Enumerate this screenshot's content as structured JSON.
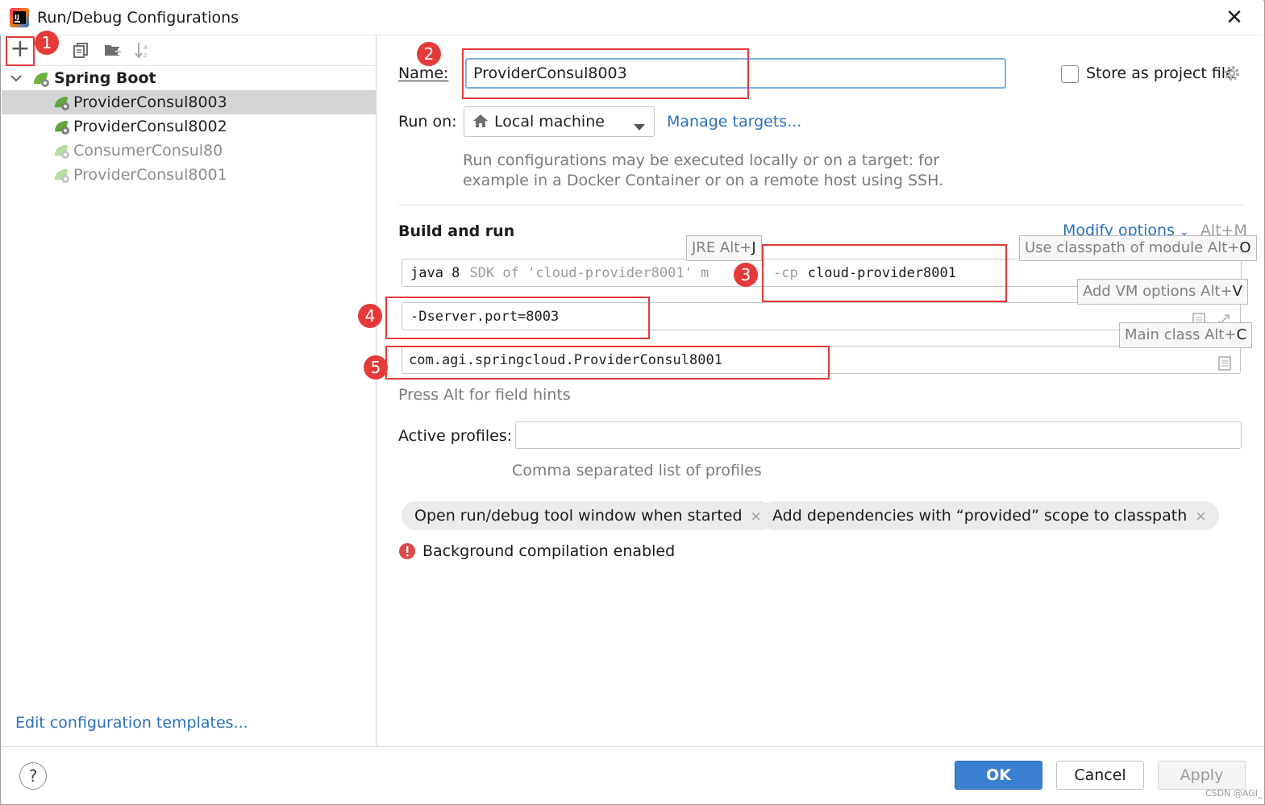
{
  "window": {
    "title": "Run/Debug Configurations",
    "close_glyph": "✕"
  },
  "toolbar": {
    "add_glyph": "+",
    "copy_icon": "copy-icon",
    "folder_icon": "new-folder-icon",
    "sort_icon": "sort-icon"
  },
  "tree": {
    "group_label": "Spring Boot",
    "items": [
      {
        "label": "ProviderConsul8003",
        "selected": true,
        "dimmed": false
      },
      {
        "label": "ProviderConsul8002",
        "selected": false,
        "dimmed": false
      },
      {
        "label": "ConsumerConsul80",
        "selected": false,
        "dimmed": true
      },
      {
        "label": "ProviderConsul8001",
        "selected": false,
        "dimmed": true
      }
    ]
  },
  "left_footer": {
    "edit_templates": "Edit configuration templates..."
  },
  "form": {
    "name_label": "Name:",
    "name_value": "ProviderConsul8003",
    "store_label": "Store as project file",
    "run_on_label": "Run on:",
    "run_on_value": "Local machine",
    "manage_targets": "Manage targets...",
    "run_hint_line1": "Run configurations may be executed locally or on a target: for",
    "run_hint_line2": "example in a Docker Container or on a remote host using SSH.",
    "build_run_title": "Build and run",
    "modify_options": "Modify options",
    "modify_shortcut": "Alt+M",
    "jre_value": "java 8",
    "jre_detail": "SDK of 'cloud-provider8001' m",
    "cp_prefix": "-cp",
    "cp_value": "cloud-provider8001",
    "vm_options_value": "-Dserver.port=8003",
    "main_class_value": "com.agi.springcloud.ProviderConsul8001",
    "field_hints": "Press Alt for field hints",
    "active_profiles_label": "Active profiles:",
    "active_profiles_value": "",
    "profiles_hint": "Comma separated list of profiles",
    "chip1": "Open run/debug tool window when started",
    "chip2": "Add dependencies with “provided” scope to classpath",
    "chip_close": "×",
    "warning_text": "Background compilation enabled"
  },
  "tooltips": {
    "jre": "JRE Alt+",
    "jre_key": "J",
    "classpath": "Use classpath of module Alt+",
    "classpath_key": "O",
    "vm": "Add VM options Alt+",
    "vm_key": "V",
    "main": "Main class Alt+",
    "main_key": "C"
  },
  "badges": [
    "1",
    "2",
    "3",
    "4",
    "5"
  ],
  "buttons": {
    "help": "?",
    "ok": "OK",
    "cancel": "Cancel",
    "apply": "Apply"
  },
  "watermark": "CSDN @AGI_",
  "colors": {
    "accent": "#3b7fd0",
    "link": "#2b6fbd",
    "annotation_red": "#e23a3a",
    "selected_row": "#d5d5d5"
  }
}
